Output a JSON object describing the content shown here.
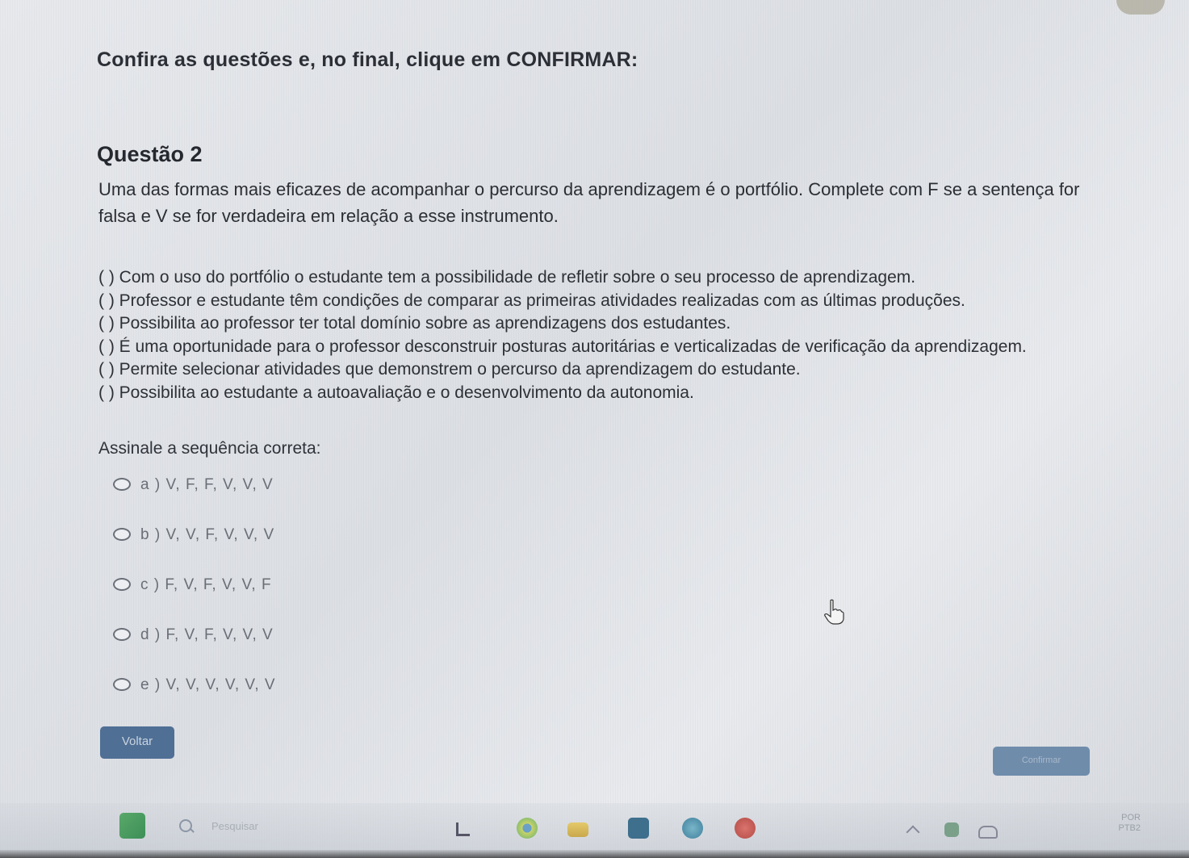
{
  "instruction": "Confira as questões e, no final, clique em CONFIRMAR:",
  "question": {
    "title": "Questão 2",
    "prompt_line1": "Uma das formas mais eficazes de acompanhar o percurso da aprendizagem é o portfólio. Complete com F se a sentença for",
    "prompt_line2": "falsa e V se for verdadeira em relação a esse instrumento.",
    "statements": [
      "( ) Com o uso do portfólio o estudante tem a possibilidade de refletir sobre o seu processo de aprendizagem.",
      "( ) Professor e estudante têm condições de comparar as primeiras atividades realizadas com as últimas produções.",
      "( ) Possibilita ao professor ter total domínio sobre as aprendizagens dos estudantes.",
      "( ) É uma oportunidade para o professor desconstruir posturas autoritárias e verticalizadas de verificação da aprendizagem.",
      "( ) Permite selecionar atividades que demonstrem o percurso da aprendizagem do estudante.",
      "( ) Possibilita ao estudante a autoavaliação e o desenvolvimento da autonomia."
    ],
    "assinale": "Assinale a sequência correta:",
    "options": [
      "a ) V, F, F, V, V, V",
      "b ) V, V, F, V, V, V",
      "c ) F, V, F, V, V, F",
      "d ) F, V, F, V, V, V",
      "e ) V, V, V, V, V, V"
    ]
  },
  "buttons": {
    "voltar": "Voltar",
    "confirmar": "Confirmar"
  },
  "taskbar": {
    "search_placeholder": "Pesquisar",
    "tray_line1": "POR",
    "tray_line2": "PTB2"
  },
  "colors": {
    "voltar_button": "#4f6f95",
    "confirmar_button": "#6f8cab",
    "page_background": "#e2e4e8"
  }
}
